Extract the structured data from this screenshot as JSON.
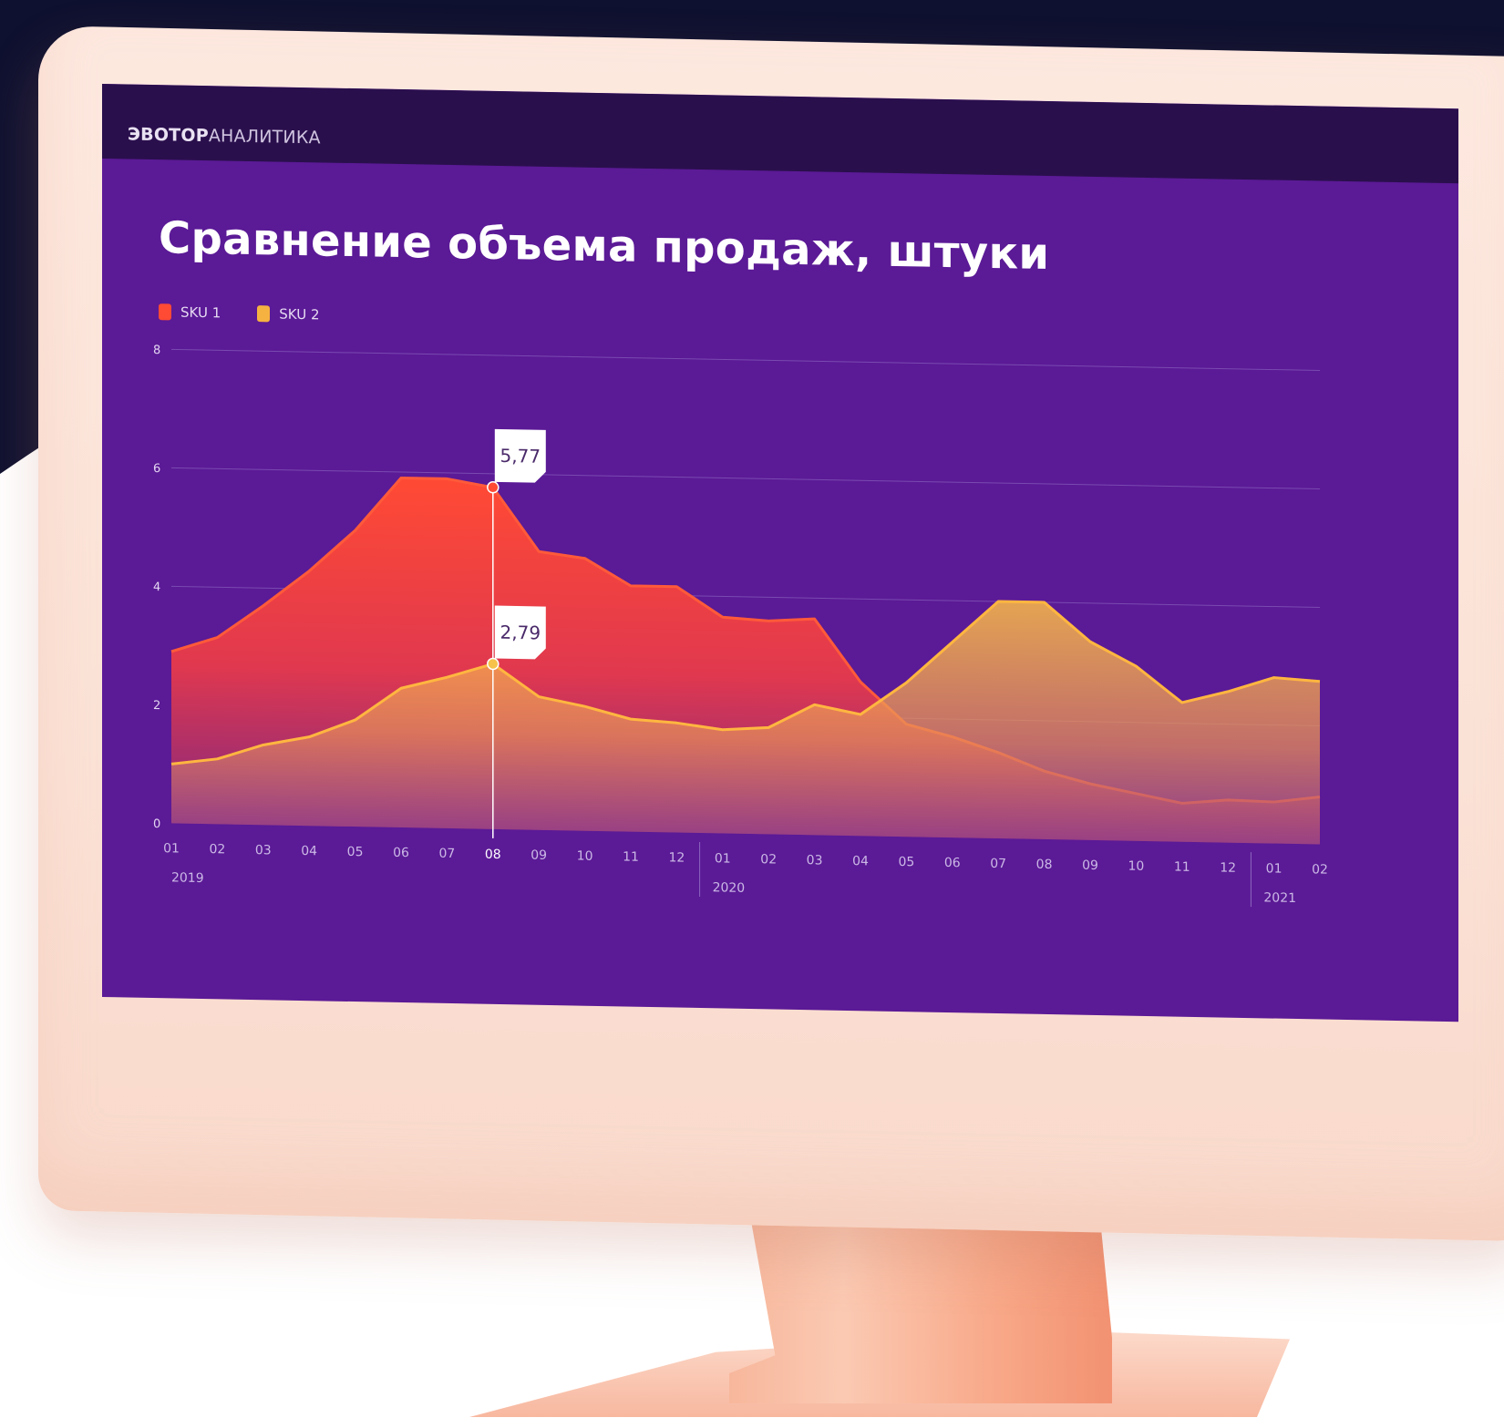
{
  "brand": {
    "bold": "ЭВОТОР",
    "light": "АНАЛИТИКА"
  },
  "colors": {
    "background_dark": "#0f1130",
    "screen": "#5b1a96",
    "topbar": "#2a0f4d",
    "sku1": "#ff4a34",
    "sku2": "#f6b240"
  },
  "chart_data": {
    "type": "area",
    "title": "Сравнение объема продаж, штуки",
    "x": [
      "01",
      "02",
      "03",
      "04",
      "05",
      "06",
      "07",
      "08",
      "09",
      "10",
      "11",
      "12",
      "01",
      "02",
      "03",
      "04",
      "05",
      "06",
      "07",
      "08",
      "09",
      "10",
      "11",
      "12",
      "01",
      "02"
    ],
    "year_labels": [
      {
        "label": "2019",
        "index": 0
      },
      {
        "label": "2020",
        "index": 12
      },
      {
        "label": "2021",
        "index": 24
      }
    ],
    "ylim": [
      0,
      8
    ],
    "yticks": [
      "0",
      "2",
      "4",
      "6",
      "8"
    ],
    "grid": true,
    "legend": "top-left",
    "series": [
      {
        "name": "SKU 1",
        "values": [
          2.9,
          3.15,
          3.7,
          4.3,
          5.0,
          5.9,
          5.9,
          5.77,
          4.7,
          4.6,
          4.15,
          4.15,
          3.65,
          3.6,
          3.65,
          2.6,
          1.9,
          1.7,
          1.45,
          1.15,
          0.95,
          0.8,
          0.65,
          0.72,
          0.7,
          0.8
        ]
      },
      {
        "name": "SKU 2",
        "values": [
          1.0,
          1.1,
          1.35,
          1.5,
          1.8,
          2.35,
          2.55,
          2.79,
          2.25,
          2.1,
          1.9,
          1.85,
          1.75,
          1.8,
          2.2,
          2.05,
          2.6,
          3.3,
          4.0,
          4.0,
          3.35,
          2.95,
          2.35,
          2.55,
          2.8,
          2.75
        ]
      }
    ],
    "highlight": {
      "index": 7,
      "labels": [
        "5,77",
        "2,79"
      ]
    }
  }
}
